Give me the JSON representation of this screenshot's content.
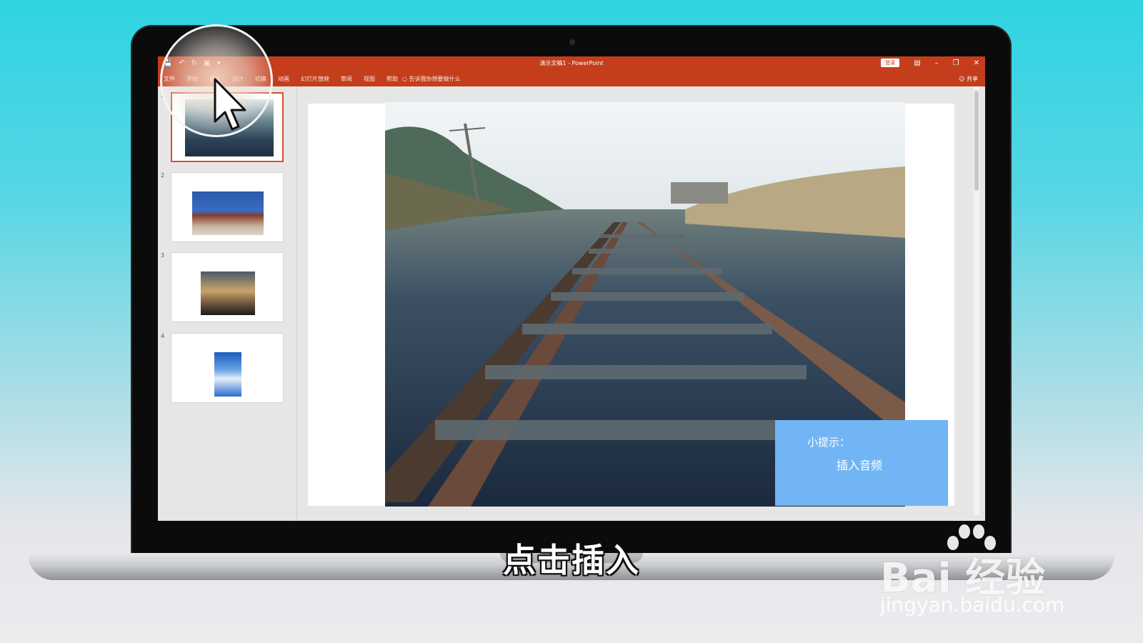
{
  "window": {
    "doc_title": "演示文稿1 - PowerPoint",
    "signin_label": "登录"
  },
  "ribbon": {
    "tabs": [
      "文件",
      "开始",
      "插入",
      "设计",
      "切换",
      "动画",
      "幻灯片放映",
      "审阅",
      "视图",
      "帮助"
    ],
    "tell_me": "告诉我你想要做什么",
    "share_label": "共享"
  },
  "thumbnails": [
    {
      "number": "1",
      "active": true,
      "picture": "railway"
    },
    {
      "number": "2",
      "active": false,
      "picture": "tiananmen"
    },
    {
      "number": "3",
      "active": false,
      "picture": "sunset-clouds"
    },
    {
      "number": "4",
      "active": false,
      "picture": "blue-sky"
    }
  ],
  "slide": {
    "tip_title": "小提示：",
    "tip_body": "插入音频"
  },
  "subtitle": "点击插入",
  "watermark": {
    "logo": "Bai 经验",
    "url": "jingyan.baidu.com"
  },
  "colors": {
    "ribbon": "#c43e1c",
    "tip_box": "#72b5f4",
    "active_thumb_border": "#d35230"
  }
}
